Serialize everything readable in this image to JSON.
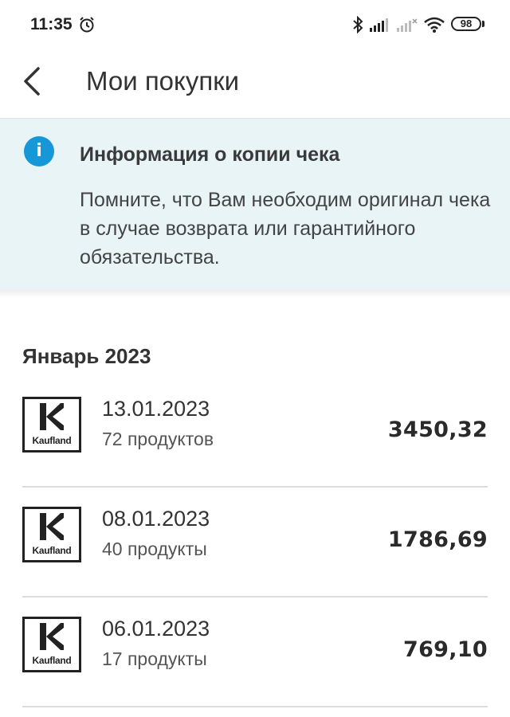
{
  "status_bar": {
    "time": "11:35",
    "battery": "98"
  },
  "header": {
    "title": "Мои покупки"
  },
  "info": {
    "title": "Информация о копии чека",
    "text": "Помните, что Вам необходим оригинал чека в случае возврата или гарантийного обязательства.",
    "icon": "info-icon",
    "accent_color": "#1597d8",
    "background_color": "#e8f4f6"
  },
  "month": {
    "label": "Январь 2023"
  },
  "purchases": [
    {
      "store": "Kaufland",
      "date": "13.01.2023",
      "count": "72 продуктов",
      "amount": "3450,32"
    },
    {
      "store": "Kaufland",
      "date": "08.01.2023",
      "count": "40 продукты",
      "amount": "1786,69"
    },
    {
      "store": "Kaufland",
      "date": "06.01.2023",
      "count": "17 продукты",
      "amount": "769,10"
    }
  ]
}
